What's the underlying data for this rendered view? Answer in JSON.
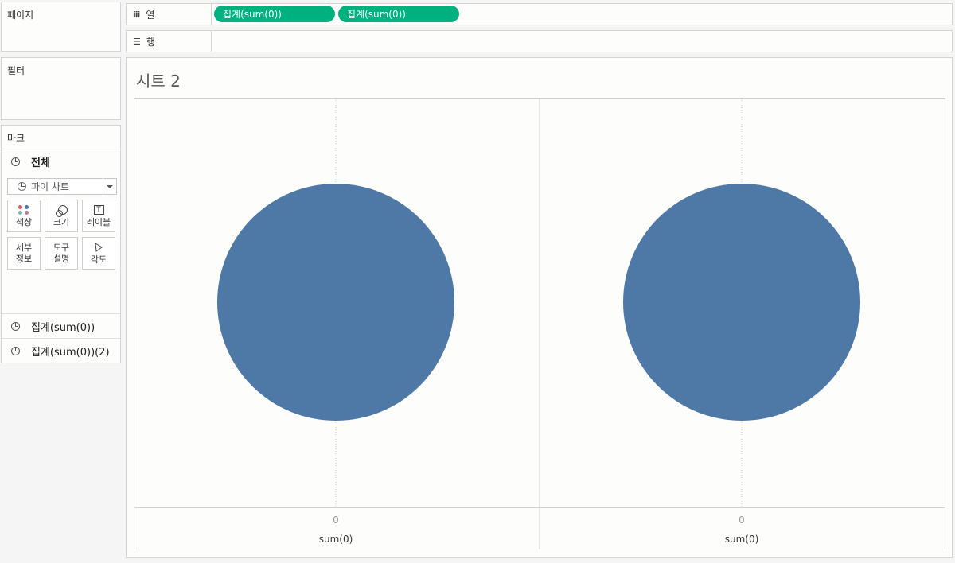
{
  "panels": {
    "pages_title": "페이지",
    "filters_title": "필터",
    "marks_title": "마크"
  },
  "marks": {
    "all_label": "전체",
    "mark_type": "파이 차트",
    "buttons": {
      "color": "색상",
      "size": "크기",
      "label": "레이블",
      "detail_line1": "세부",
      "detail_line2": "정보",
      "tooltip_line1": "도구",
      "tooltip_line2": "설명",
      "angle": "각도"
    },
    "measure_cards": [
      "집계(sum(0))",
      "집계(sum(0))(2)"
    ]
  },
  "shelves": {
    "columns_label": "열",
    "rows_label": "행",
    "column_pills": [
      "집계(sum(0))",
      "집계(sum(0))"
    ]
  },
  "sheet": {
    "title": "시트 2"
  },
  "colors": {
    "pill": "#00b180",
    "pie": "#4e79a7",
    "color_dots": [
      "#e15759",
      "#4e79a7",
      "#76b7b2",
      "#af7aa1"
    ]
  },
  "chart_data": [
    {
      "type": "pie",
      "series": [
        {
          "values": [
            100
          ]
        }
      ],
      "xlabel": "sum(0)",
      "x_tick_labels": [
        "0"
      ]
    },
    {
      "type": "pie",
      "series": [
        {
          "values": [
            100
          ]
        }
      ],
      "xlabel": "sum(0)",
      "x_tick_labels": [
        "0"
      ]
    }
  ]
}
